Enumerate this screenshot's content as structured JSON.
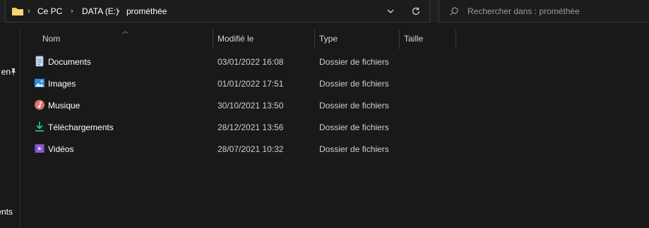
{
  "address_bar": {
    "breadcrumbs": [
      "Ce PC",
      "DATA (E:)",
      "prométhée"
    ]
  },
  "search": {
    "placeholder": "Rechercher dans : prométhée"
  },
  "nav_pane": {
    "items": [
      {
        "label": "en",
        "pinned": true
      },
      {
        "label": "ents",
        "pinned": false
      }
    ]
  },
  "columns": {
    "name": "Nom",
    "modified": "Modifié le",
    "type": "Type",
    "size": "Taille"
  },
  "files": [
    {
      "name": "Documents",
      "modified": "03/01/2022 16:08",
      "type": "Dossier de fichiers",
      "icon": "documents-folder-icon"
    },
    {
      "name": "Images",
      "modified": "01/01/2022 17:51",
      "type": "Dossier de fichiers",
      "icon": "pictures-folder-icon"
    },
    {
      "name": "Musique",
      "modified": "30/10/2021 13:50",
      "type": "Dossier de fichiers",
      "icon": "music-folder-icon"
    },
    {
      "name": "Téléchargements",
      "modified": "28/12/2021 13:56",
      "type": "Dossier de fichiers",
      "icon": "downloads-folder-icon"
    },
    {
      "name": "Vidéos",
      "modified": "28/07/2021 10:32",
      "type": "Dossier de fichiers",
      "icon": "videos-folder-icon"
    }
  ],
  "colors": {
    "background": "#191919",
    "toolbar": "#202020",
    "folder": "#f2c94c"
  }
}
